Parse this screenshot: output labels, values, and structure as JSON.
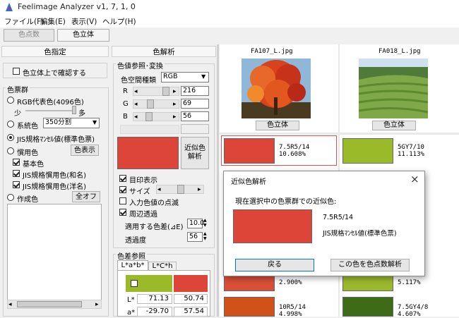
{
  "app": {
    "title": "Feelimage Analyzer v1, 7, 1, 0"
  },
  "menu": [
    "ファイル(F)",
    "編集(E)",
    "表示(V)",
    "ヘルプ(H)"
  ],
  "modes": {
    "point_label": "色点数",
    "solid_label": "色立体"
  },
  "color_spec": {
    "title": "色指定",
    "confirm_in_solid": "色立体上で確認する",
    "color_group_title": "色票群",
    "rgb_rep": "RGB代表色(4096色)",
    "few": "少",
    "many": "多",
    "system_color": "系統色",
    "system_select": "350分割",
    "jis_munsell": "JIS規格ﾏﾝｾﾙ値(標準色票)",
    "usage_color": "慣用色",
    "show_button": "色表示",
    "basic": "基本色",
    "jis_japanese": "JIS規格慣用色(和名)",
    "jis_western": "JIS規格慣用色(洋名)",
    "created": "作成色",
    "all_off": "全オフ"
  },
  "color_analysis": {
    "title": "色解析",
    "ref_title": "色値参照･変換",
    "space_label": "色空間種類",
    "space_value": "RGB",
    "r_label": "R",
    "r_value": "216",
    "g_label": "G",
    "g_value": "69",
    "b_label": "B",
    "b_value": "56",
    "swatch": "#dc4538",
    "approx_button_1": "近似色",
    "approx_button_2": "解析",
    "mark_display": "目印表示",
    "size_label": "サイズ",
    "blink_input": "入力色値の点滅",
    "surround_transparent": "周辺透過",
    "apply_delta": "適用する色差(⊿E)",
    "apply_delta_value": "10.0",
    "transparency": "透過度",
    "transparency_value": "56",
    "diff_title": "色差参照",
    "tab_lab": "L*a*b*",
    "tab_lch": "L*C*h",
    "diff_swatch_left": "#9bba2a",
    "diff_swatch_right": "#dc4538",
    "L_label": "L*",
    "L_left": "71.13",
    "L_right": "50.74",
    "a_label": "a*",
    "a_left": "-29.70",
    "a_right": "57.54"
  },
  "images": [
    {
      "name": "FA107_L.jpg",
      "button": "色立体"
    },
    {
      "name": "FA018_L.jpg",
      "button": "色立体"
    }
  ],
  "add_icon": "+",
  "results_col1": [
    {
      "color": "#dc4538",
      "label": "7.5R5/14",
      "pct": "10.608%"
    },
    {
      "color": "#d94f38",
      "label": "",
      "pct": "2.900%"
    },
    {
      "color": "#d05218",
      "label": "10R5/14",
      "pct": "4.998%"
    }
  ],
  "results_col2": [
    {
      "color": "#9bba2a",
      "label": "5GY7/10",
      "pct": "11.113%"
    },
    {
      "color": "#9cb82e",
      "label": "",
      "pct": "5.117%"
    },
    {
      "color": "#3d6b18",
      "label": "7.5GY4/8",
      "pct": "4.607%"
    }
  ],
  "dialog": {
    "title": "近似色解析",
    "close_icon": "×",
    "prompt": "現在選択中の色票群での近似色:",
    "swatch": "#dc4538",
    "value": "7.5R5/14",
    "group": "JIS規格ﾏﾝｾﾙ値(標準色票)",
    "back_button": "戻る",
    "analyze_button": "この色を色点数解析"
  }
}
